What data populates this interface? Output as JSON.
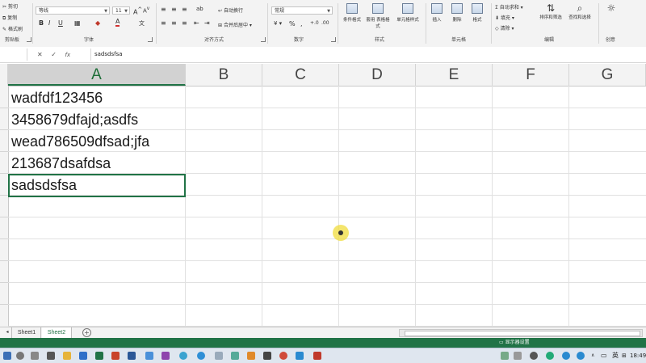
{
  "ribbon": {
    "clipboard": {
      "cut": "剪切",
      "copy": "复制",
      "format_painter": "格式刷",
      "group": "剪贴板"
    },
    "font": {
      "font_name": "等线",
      "font_size": "11",
      "bold": "B",
      "italic": "I",
      "underline": "U",
      "grow": "A",
      "shrink": "A",
      "color_a": "A",
      "group": "字体"
    },
    "alignment": {
      "wrap": "自动换行",
      "merge": "合并后居中",
      "group": "对齐方式"
    },
    "number": {
      "format": "常规",
      "percent": "%",
      "comma": ",",
      "group": "数字"
    },
    "styles": {
      "conditional": "条件格式",
      "as_table": "套用 表格格式",
      "cell_styles": "单元格样式",
      "group": "样式"
    },
    "cells": {
      "insert": "插入",
      "delete": "删除",
      "format": "格式",
      "group": "单元格"
    },
    "editing": {
      "autosum": "自动求和",
      "fill": "填充",
      "clear": "清除",
      "sort_filter": "排序和筛选",
      "find_select": "查找和选择",
      "group": "编辑"
    },
    "ideas": {
      "group": "创意"
    }
  },
  "formula_bar": {
    "name_box": "",
    "cancel": "✕",
    "enter": "✓",
    "fx": "fx",
    "content": "sadsdsfsa"
  },
  "columns": [
    "A",
    "B",
    "C",
    "D",
    "E",
    "F",
    "G"
  ],
  "cells": [
    "wadfdf123456",
    "3458679dfajd;asdfs",
    "wead786509dfsad;jfa",
    "213687dsafdsa",
    "sadsdsfsa"
  ],
  "sheets": [
    "Sheet1",
    "Sheet2"
  ],
  "add_sheet": "+",
  "status": {
    "display_settings": "显示器设置"
  },
  "taskbar": {
    "ime": "英",
    "time": "18:49"
  },
  "colors": {
    "excel_green": "#217346",
    "cursor_highlight": "#f0dc3c"
  }
}
